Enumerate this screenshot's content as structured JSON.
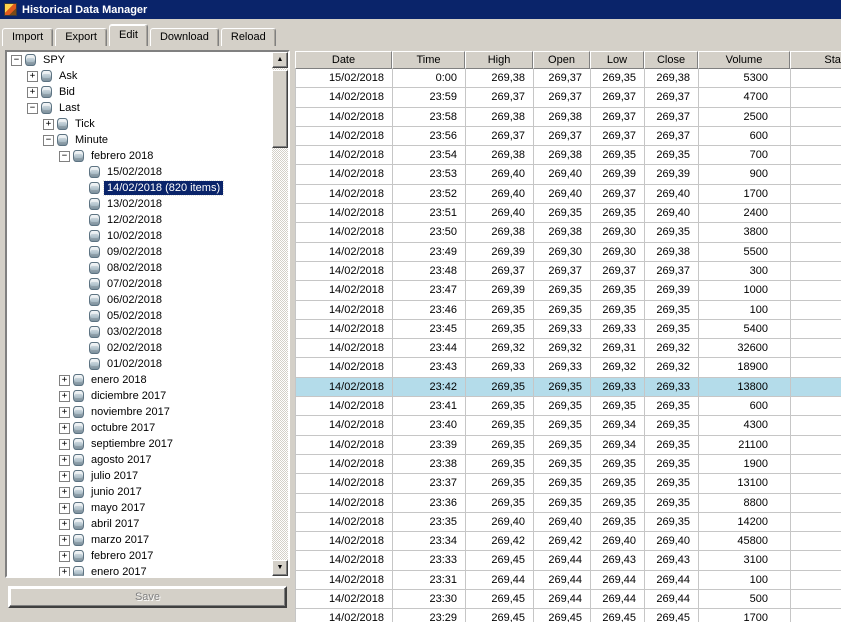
{
  "titlebar": {
    "title": "Historical Data Manager"
  },
  "tabs": {
    "items": [
      {
        "label": "Import",
        "active": false
      },
      {
        "label": "Export",
        "active": false
      },
      {
        "label": "Edit",
        "active": true
      },
      {
        "label": "Download",
        "active": false
      },
      {
        "label": "Reload",
        "active": false
      }
    ]
  },
  "tree": {
    "items": [
      {
        "label": "SPY",
        "depth": 0,
        "toggle": "minus",
        "selected": false
      },
      {
        "label": "Ask",
        "depth": 1,
        "toggle": "plus",
        "selected": false
      },
      {
        "label": "Bid",
        "depth": 1,
        "toggle": "plus",
        "selected": false
      },
      {
        "label": "Last",
        "depth": 1,
        "toggle": "minus",
        "selected": false
      },
      {
        "label": "Tick",
        "depth": 2,
        "toggle": "plus",
        "selected": false
      },
      {
        "label": "Minute",
        "depth": 2,
        "toggle": "minus",
        "selected": false
      },
      {
        "label": "febrero 2018",
        "depth": 3,
        "toggle": "minus",
        "selected": false
      },
      {
        "label": "15/02/2018",
        "depth": 4,
        "toggle": "none",
        "selected": false
      },
      {
        "label": "14/02/2018 (820 items)",
        "depth": 4,
        "toggle": "none",
        "selected": true
      },
      {
        "label": "13/02/2018",
        "depth": 4,
        "toggle": "none",
        "selected": false
      },
      {
        "label": "12/02/2018",
        "depth": 4,
        "toggle": "none",
        "selected": false
      },
      {
        "label": "10/02/2018",
        "depth": 4,
        "toggle": "none",
        "selected": false
      },
      {
        "label": "09/02/2018",
        "depth": 4,
        "toggle": "none",
        "selected": false
      },
      {
        "label": "08/02/2018",
        "depth": 4,
        "toggle": "none",
        "selected": false
      },
      {
        "label": "07/02/2018",
        "depth": 4,
        "toggle": "none",
        "selected": false
      },
      {
        "label": "06/02/2018",
        "depth": 4,
        "toggle": "none",
        "selected": false
      },
      {
        "label": "05/02/2018",
        "depth": 4,
        "toggle": "none",
        "selected": false
      },
      {
        "label": "03/02/2018",
        "depth": 4,
        "toggle": "none",
        "selected": false
      },
      {
        "label": "02/02/2018",
        "depth": 4,
        "toggle": "none",
        "selected": false
      },
      {
        "label": "01/02/2018",
        "depth": 4,
        "toggle": "none",
        "selected": false
      },
      {
        "label": "enero 2018",
        "depth": 3,
        "toggle": "plus",
        "selected": false
      },
      {
        "label": "diciembre 2017",
        "depth": 3,
        "toggle": "plus",
        "selected": false
      },
      {
        "label": "noviembre 2017",
        "depth": 3,
        "toggle": "plus",
        "selected": false
      },
      {
        "label": "octubre 2017",
        "depth": 3,
        "toggle": "plus",
        "selected": false
      },
      {
        "label": "septiembre 2017",
        "depth": 3,
        "toggle": "plus",
        "selected": false
      },
      {
        "label": "agosto 2017",
        "depth": 3,
        "toggle": "plus",
        "selected": false
      },
      {
        "label": "julio 2017",
        "depth": 3,
        "toggle": "plus",
        "selected": false
      },
      {
        "label": "junio 2017",
        "depth": 3,
        "toggle": "plus",
        "selected": false
      },
      {
        "label": "mayo 2017",
        "depth": 3,
        "toggle": "plus",
        "selected": false
      },
      {
        "label": "abril 2017",
        "depth": 3,
        "toggle": "plus",
        "selected": false
      },
      {
        "label": "marzo 2017",
        "depth": 3,
        "toggle": "plus",
        "selected": false
      },
      {
        "label": "febrero 2017",
        "depth": 3,
        "toggle": "plus",
        "selected": false
      },
      {
        "label": "enero 2017",
        "depth": 3,
        "toggle": "plus",
        "selected": false
      }
    ]
  },
  "save_button": {
    "label": "Save",
    "enabled": false
  },
  "grid": {
    "columns": [
      {
        "label": "Date"
      },
      {
        "label": "Time"
      },
      {
        "label": "High"
      },
      {
        "label": "Open"
      },
      {
        "label": "Low"
      },
      {
        "label": "Close"
      },
      {
        "label": "Volume"
      },
      {
        "label": "Status"
      }
    ],
    "selected_row": 16,
    "rows": [
      [
        "15/02/2018",
        "0:00",
        "269,38",
        "269,37",
        "269,35",
        "269,38",
        "5300",
        ""
      ],
      [
        "14/02/2018",
        "23:59",
        "269,37",
        "269,37",
        "269,37",
        "269,37",
        "4700",
        ""
      ],
      [
        "14/02/2018",
        "23:58",
        "269,38",
        "269,38",
        "269,37",
        "269,37",
        "2500",
        ""
      ],
      [
        "14/02/2018",
        "23:56",
        "269,37",
        "269,37",
        "269,37",
        "269,37",
        "600",
        ""
      ],
      [
        "14/02/2018",
        "23:54",
        "269,38",
        "269,38",
        "269,35",
        "269,35",
        "700",
        ""
      ],
      [
        "14/02/2018",
        "23:53",
        "269,40",
        "269,40",
        "269,39",
        "269,39",
        "900",
        ""
      ],
      [
        "14/02/2018",
        "23:52",
        "269,40",
        "269,40",
        "269,37",
        "269,40",
        "1700",
        ""
      ],
      [
        "14/02/2018",
        "23:51",
        "269,40",
        "269,35",
        "269,35",
        "269,40",
        "2400",
        ""
      ],
      [
        "14/02/2018",
        "23:50",
        "269,38",
        "269,38",
        "269,30",
        "269,35",
        "3800",
        ""
      ],
      [
        "14/02/2018",
        "23:49",
        "269,39",
        "269,30",
        "269,30",
        "269,38",
        "5500",
        ""
      ],
      [
        "14/02/2018",
        "23:48",
        "269,37",
        "269,37",
        "269,37",
        "269,37",
        "300",
        ""
      ],
      [
        "14/02/2018",
        "23:47",
        "269,39",
        "269,35",
        "269,35",
        "269,39",
        "1000",
        ""
      ],
      [
        "14/02/2018",
        "23:46",
        "269,35",
        "269,35",
        "269,35",
        "269,35",
        "100",
        ""
      ],
      [
        "14/02/2018",
        "23:45",
        "269,35",
        "269,33",
        "269,33",
        "269,35",
        "5400",
        ""
      ],
      [
        "14/02/2018",
        "23:44",
        "269,32",
        "269,32",
        "269,31",
        "269,32",
        "32600",
        ""
      ],
      [
        "14/02/2018",
        "23:43",
        "269,33",
        "269,33",
        "269,32",
        "269,32",
        "18900",
        ""
      ],
      [
        "14/02/2018",
        "23:42",
        "269,35",
        "269,35",
        "269,33",
        "269,33",
        "13800",
        ""
      ],
      [
        "14/02/2018",
        "23:41",
        "269,35",
        "269,35",
        "269,35",
        "269,35",
        "600",
        ""
      ],
      [
        "14/02/2018",
        "23:40",
        "269,35",
        "269,35",
        "269,34",
        "269,35",
        "4300",
        ""
      ],
      [
        "14/02/2018",
        "23:39",
        "269,35",
        "269,35",
        "269,34",
        "269,35",
        "21100",
        ""
      ],
      [
        "14/02/2018",
        "23:38",
        "269,35",
        "269,35",
        "269,35",
        "269,35",
        "1900",
        ""
      ],
      [
        "14/02/2018",
        "23:37",
        "269,35",
        "269,35",
        "269,35",
        "269,35",
        "13100",
        ""
      ],
      [
        "14/02/2018",
        "23:36",
        "269,35",
        "269,35",
        "269,35",
        "269,35",
        "8800",
        ""
      ],
      [
        "14/02/2018",
        "23:35",
        "269,40",
        "269,40",
        "269,35",
        "269,35",
        "14200",
        ""
      ],
      [
        "14/02/2018",
        "23:34",
        "269,42",
        "269,42",
        "269,40",
        "269,40",
        "45800",
        ""
      ],
      [
        "14/02/2018",
        "23:33",
        "269,45",
        "269,44",
        "269,43",
        "269,43",
        "3100",
        ""
      ],
      [
        "14/02/2018",
        "23:31",
        "269,44",
        "269,44",
        "269,44",
        "269,44",
        "100",
        ""
      ],
      [
        "14/02/2018",
        "23:30",
        "269,45",
        "269,44",
        "269,44",
        "269,44",
        "500",
        ""
      ],
      [
        "14/02/2018",
        "23:29",
        "269,45",
        "269,45",
        "269,45",
        "269,45",
        "1700",
        ""
      ]
    ]
  },
  "colors": {
    "title_bar": "#0a246a",
    "tree_selection": "#0a246a",
    "row_highlight": "#b4dcea"
  }
}
